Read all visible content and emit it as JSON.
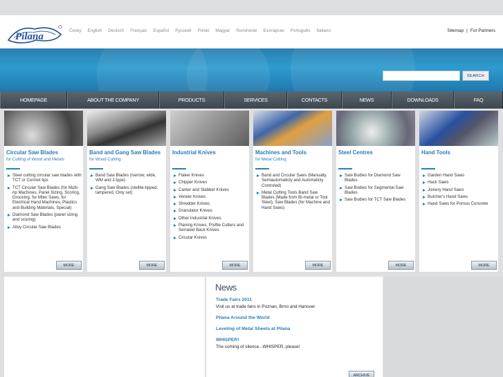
{
  "brand": {
    "logo_text": "Pilana"
  },
  "languages": [
    "Česky",
    "English",
    "Deutsch",
    "Français",
    "Español",
    "Русский",
    "Polski",
    "Magyar",
    "Romineste",
    "Български",
    "Português",
    "Italiano"
  ],
  "top_links": {
    "sitemap": "Sitemap",
    "separator": "|",
    "partners": "For Partners"
  },
  "search": {
    "button_label": "SEARCH",
    "value": ""
  },
  "nav": [
    "HOMEPAGE",
    "ABOUT THE COMPANY",
    "PRODUCTS",
    "SERVICES",
    "CONTACTS",
    "NEWS",
    "DOWNLOADS",
    "FAQ"
  ],
  "cards": [
    {
      "title": "Circular Saw Blades",
      "subtitle": "for Cutting of Wood and Metals",
      "items": [
        "Steel cutting circular saw blades with TCT or Cermet tips",
        "TCT Circular Saw Blades (for Multi-rip Machines, Panel Sizing, Scoring, Grooving, for Miter Saws, for Electrical Hand Machines, Plastics and Building Materials, Special)",
        "Diamond Saw Blades (panel sizing and scoring)",
        "Alloy Circular Saw Blades"
      ],
      "more": "MORE"
    },
    {
      "title": "Band and Gang Saw Blades",
      "subtitle": "for Wood Cutting",
      "items": [
        "Band Saw Blades (narrow, wide, WM and J-type)",
        "Gang Saw Blades (stellite-tipped, tampered, Only set)"
      ],
      "more": "MORE"
    },
    {
      "title": "Industrial Knives",
      "subtitle": "",
      "items": [
        "Flaker Knives",
        "Chipper Knives",
        "Canter and Slabber Knives",
        "Veneer Knives",
        "Shredder Knives",
        "Granulator Knives",
        "Other Industrial Knives",
        "Planing Knives, Profile Cutters and Serrated Back Knives",
        "Circular Knives"
      ],
      "more": "MORE"
    },
    {
      "title": "Machines and Tools",
      "subtitle": "for Metal Cutting",
      "items": [
        "Band and Circular Saws (Manually, Semiautomaticly and Automaticly Controled)",
        "Metal Cutting Tools Band Saw Blades (Made from Bi-metal or Tool Steel), Saw Blades (for Machine and Hand Saws)"
      ],
      "more": "MORE"
    },
    {
      "title": "Steel Centres",
      "subtitle": "",
      "items": [
        "Saw Bodies for Diamond Saw Blades",
        "Saw Bodies for Segmental Saw Blades",
        "Saw Bodies for TCT Saw Blades"
      ],
      "more": "MORE"
    },
    {
      "title": "Hand Tools",
      "subtitle": "",
      "items": [
        "Garden Hand Saws",
        "Hack Saws",
        "Joinery Hand Saws",
        "Butcher's Hand Saws",
        "Hand Saws for Porous Concrete"
      ],
      "more": "MORE"
    }
  ],
  "news": {
    "heading": "News",
    "entries": [
      {
        "title": "Trade Fairs 2011",
        "text": "Visit us at trade fairs in Poznan, Brno and Hanover"
      },
      {
        "title": "Pilana Around the World",
        "text": ""
      },
      {
        "title": "Leveling of Metal Sheets at Pilana",
        "text": ""
      },
      {
        "title": "WHISPER!",
        "text": "The coming of silence...WHISPER, please!"
      }
    ],
    "archive_label": "ARCHIVE"
  },
  "colors": {
    "accent": "#2b7cb5",
    "nav": "#4a555e",
    "banner": "#2e9bd0",
    "page_bg": "#dedfe1"
  }
}
